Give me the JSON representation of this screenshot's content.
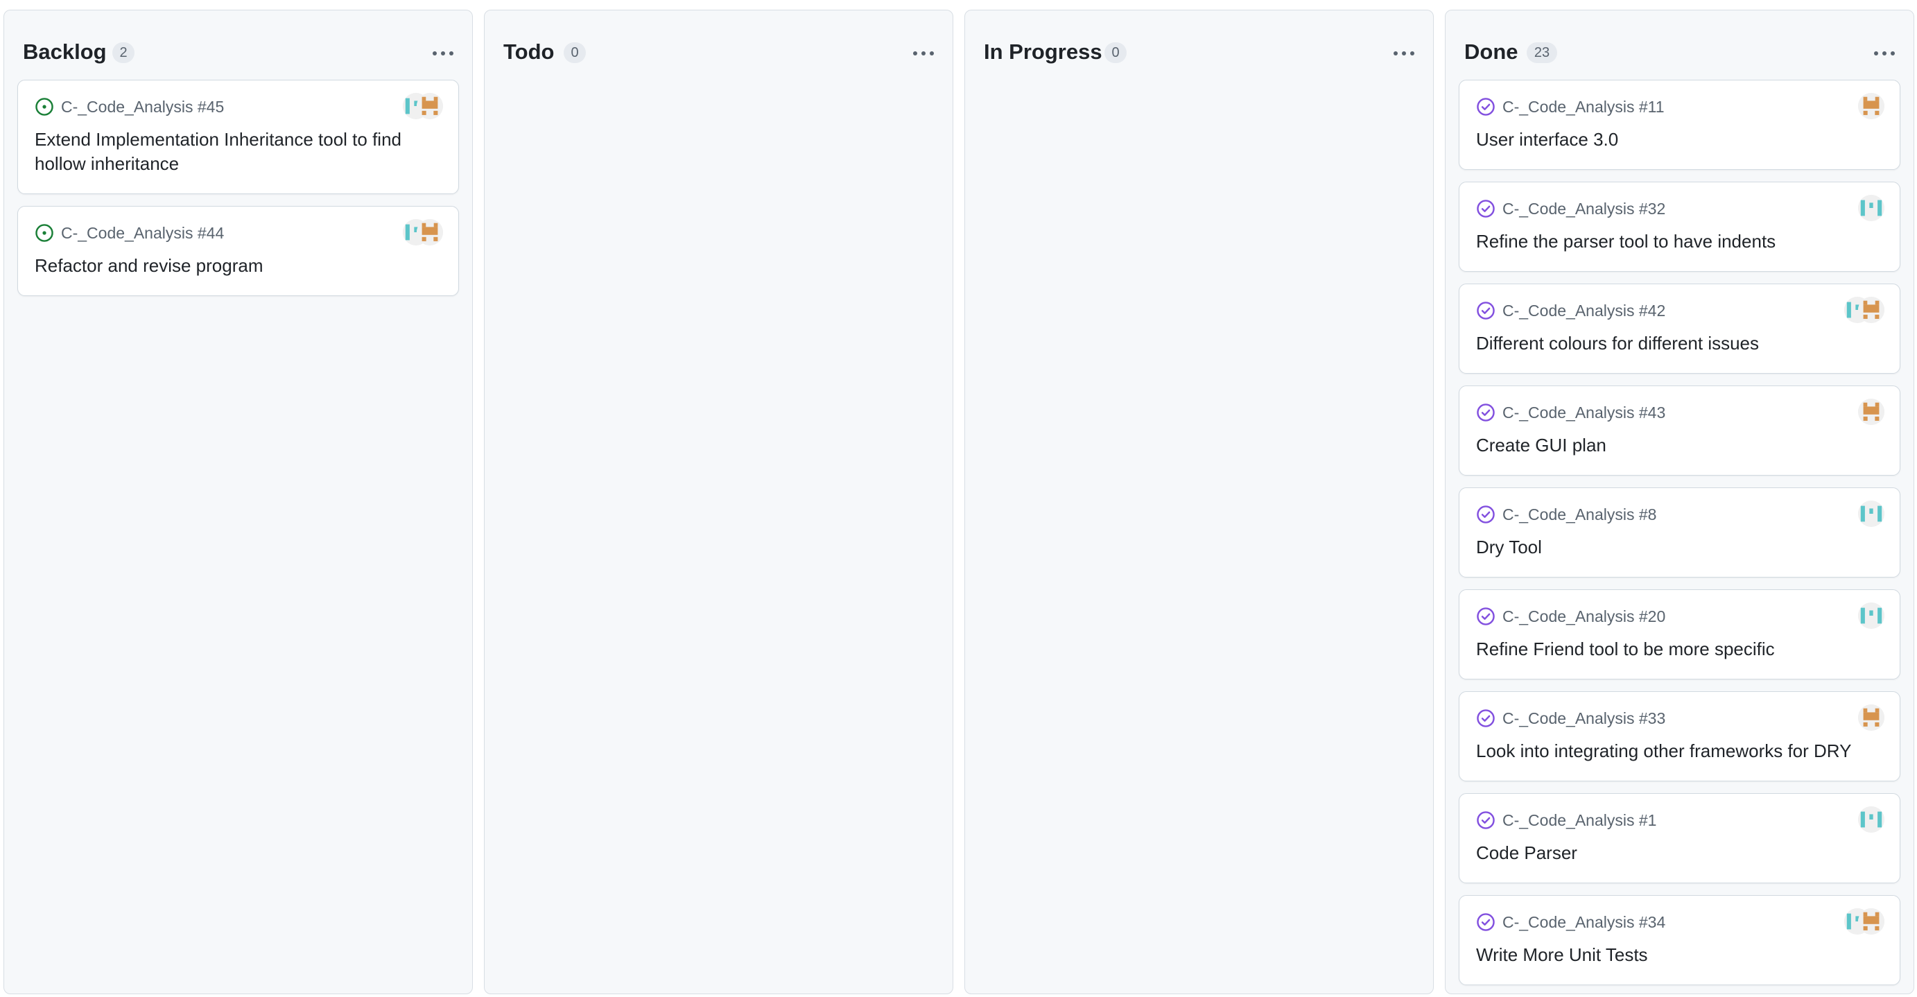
{
  "colors": {
    "open_issue": "#1a7f37",
    "closed_issue": "#8250df",
    "avatar_teal": "#5cc5c9",
    "avatar_orange": "#d7944e"
  },
  "columns": [
    {
      "title": "Backlog",
      "count": "2",
      "cards": [
        {
          "repo_ref": "C-_Code_Analysis #45",
          "title": "Extend Implementation Inheritance tool to find hollow inheritance",
          "state_icon": "open-issue-icon",
          "avatars": [
            "teal-pixel-avatar",
            "orange-pixel-avatar"
          ]
        },
        {
          "repo_ref": "C-_Code_Analysis #44",
          "title": "Refactor and revise program",
          "state_icon": "open-issue-icon",
          "avatars": [
            "teal-pixel-avatar",
            "orange-pixel-avatar"
          ]
        }
      ]
    },
    {
      "title": "Todo",
      "count": "0",
      "cards": []
    },
    {
      "title": "In Progress",
      "count": "0",
      "cards": []
    },
    {
      "title": "Done",
      "count": "23",
      "cards": [
        {
          "repo_ref": "C-_Code_Analysis #11",
          "title": "User interface 3.0",
          "state_icon": "closed-issue-icon",
          "avatars": [
            "orange-pixel-avatar"
          ]
        },
        {
          "repo_ref": "C-_Code_Analysis #32",
          "title": "Refine the parser tool to have indents",
          "state_icon": "closed-issue-icon",
          "avatars": [
            "teal-pixel-avatar"
          ]
        },
        {
          "repo_ref": "C-_Code_Analysis #42",
          "title": "Different colours for different issues",
          "state_icon": "closed-issue-icon",
          "avatars": [
            "teal-pixel-avatar",
            "orange-pixel-avatar"
          ]
        },
        {
          "repo_ref": "C-_Code_Analysis #43",
          "title": "Create GUI plan",
          "state_icon": "closed-issue-icon",
          "avatars": [
            "orange-pixel-avatar"
          ]
        },
        {
          "repo_ref": "C-_Code_Analysis #8",
          "title": "Dry Tool",
          "state_icon": "closed-issue-icon",
          "avatars": [
            "teal-pixel-avatar"
          ]
        },
        {
          "repo_ref": "C-_Code_Analysis #20",
          "title": "Refine Friend tool to be more specific",
          "state_icon": "closed-issue-icon",
          "avatars": [
            "teal-pixel-avatar"
          ]
        },
        {
          "repo_ref": "C-_Code_Analysis #33",
          "title": "Look into integrating other frameworks for DRY",
          "state_icon": "closed-issue-icon",
          "avatars": [
            "orange-pixel-avatar"
          ]
        },
        {
          "repo_ref": "C-_Code_Analysis #1",
          "title": "Code Parser",
          "state_icon": "closed-issue-icon",
          "avatars": [
            "teal-pixel-avatar"
          ]
        },
        {
          "repo_ref": "C-_Code_Analysis #34",
          "title": "Write More Unit Tests",
          "state_icon": "closed-issue-icon",
          "avatars": [
            "teal-pixel-avatar",
            "orange-pixel-avatar"
          ]
        }
      ]
    }
  ]
}
